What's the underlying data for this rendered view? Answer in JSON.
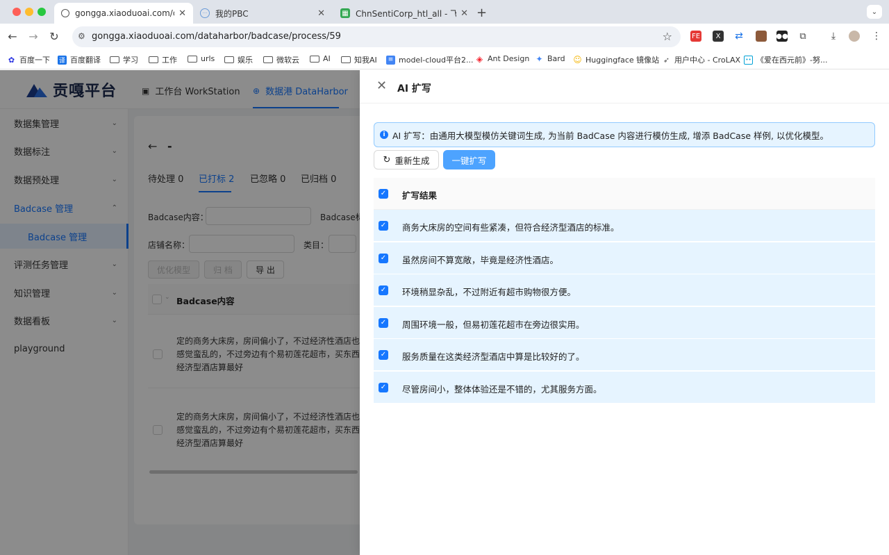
{
  "browser": {
    "tabs": [
      {
        "label": "gongga.xiaoduoai.com/dataharbor/badcase/process/59",
        "icon": "globe-icon",
        "active": true
      },
      {
        "label": "我的PBC",
        "icon": "chat-icon",
        "active": false
      },
      {
        "label": "ChnSentiCorp_htl_all - 飞书云文档",
        "icon": "sheet-icon",
        "active": false
      }
    ],
    "url": "gongga.xiaoduoai.com/dataharbor/badcase/process/59",
    "bookmarks": [
      {
        "label": "百度一下",
        "icon": "baidu-icon"
      },
      {
        "label": "百度翻译",
        "icon": "translate-icon"
      },
      {
        "label": "学习",
        "icon": "folder-icon"
      },
      {
        "label": "工作",
        "icon": "folder-icon"
      },
      {
        "label": "urls",
        "icon": "folder-icon"
      },
      {
        "label": "娱乐",
        "icon": "folder-icon"
      },
      {
        "label": "微软云",
        "icon": "folder-icon"
      },
      {
        "label": "AI",
        "icon": "folder-icon"
      },
      {
        "label": "知我AI",
        "icon": "folder-icon"
      },
      {
        "label": "model-cloud平台2...",
        "icon": "doc-icon"
      },
      {
        "label": "Ant Design",
        "icon": "antd-icon"
      },
      {
        "label": "Bard",
        "icon": "bard-icon"
      },
      {
        "label": "Huggingface 镜像站",
        "icon": "hf-icon"
      },
      {
        "label": "用户中心 - CroLAX",
        "icon": "rocket-icon"
      },
      {
        "label": "《爱在西元前》-努...",
        "icon": "bilibili-icon"
      }
    ]
  },
  "app": {
    "logo": "贡嘎平台",
    "nav": [
      {
        "label": "工作台 WorkStation",
        "active": false
      },
      {
        "label": "数据港 DataHarbor",
        "active": true
      }
    ],
    "sidebar": [
      {
        "label": "数据集管理"
      },
      {
        "label": "数据标注"
      },
      {
        "label": "数据预处理"
      },
      {
        "label": "Badcase 管理"
      },
      {
        "label": "Badcase 管理"
      },
      {
        "label": "评测任务管理"
      },
      {
        "label": "知识管理"
      },
      {
        "label": "数据看板"
      },
      {
        "label": "playground"
      }
    ],
    "page": {
      "title": "-",
      "tabs": [
        "待处理 0",
        "已打标 2",
        "已忽略 0",
        "已归档 0"
      ],
      "filters": {
        "content_label": "Badcase内容：",
        "tag_label": "Badcase标",
        "shop_label": "店铺名称：",
        "category_label": "类目："
      },
      "buttons": {
        "optimize": "优化模型",
        "archive": "归 档",
        "export": "导 出"
      },
      "table": {
        "header": "Badcase内容",
        "rows": [
          [
            "定的商务大床房，房间偏小了，不过经济性酒店也还",
            "感觉蛮乱的，不过旁边有个易初莲花超市，买东西很",
            "经济型酒店算最好"
          ],
          [
            "定的商务大床房，房间偏小了，不过经济性酒店也还",
            "感觉蛮乱的，不过旁边有个易初莲花超市，买东西很",
            "经济型酒店算最好"
          ]
        ]
      }
    }
  },
  "drawer": {
    "title": "AI 扩写",
    "alert": "AI 扩写：由通用大模型模仿关键词生成, 为当前 BadCase 内容进行模仿生成, 增添 BadCase 样例, 以优化模型。",
    "regenerate": "重新生成",
    "expand": "一键扩写",
    "result_header": "扩写结果",
    "results": [
      "商务大床房的空间有些紧凑，但符合经济型酒店的标准。",
      "虽然房间不算宽敞，毕竟是经济性酒店。",
      "环境稍显杂乱，不过附近有超市购物很方便。",
      "周围环境一般，但易初莲花超市在旁边很实用。",
      "服务质量在这类经济型酒店中算是比较好的了。",
      "尽管房间小，整体体验还是不错的，尤其服务方面。"
    ]
  }
}
